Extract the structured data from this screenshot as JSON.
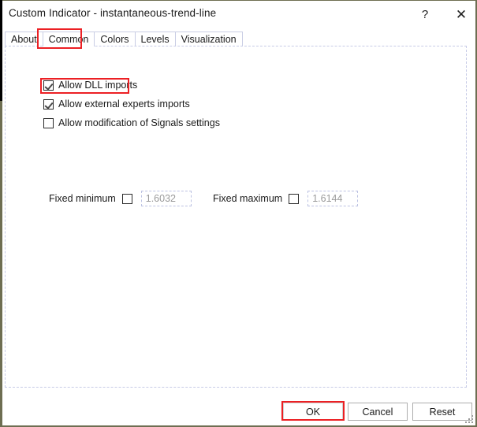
{
  "window": {
    "title": "Custom Indicator - instantaneous-trend-line",
    "help_icon": "question-mark-icon",
    "help_label": "?",
    "close_icon": "close-icon",
    "close_label": "✕"
  },
  "tabs": [
    {
      "label": "About",
      "selected": false
    },
    {
      "label": "Common",
      "selected": true
    },
    {
      "label": "Colors",
      "selected": false
    },
    {
      "label": "Levels",
      "selected": false
    },
    {
      "label": "Visualization",
      "selected": false
    }
  ],
  "common_tab": {
    "checkboxes": [
      {
        "label": "Allow DLL imports",
        "checked": true
      },
      {
        "label": "Allow external experts imports",
        "checked": true
      },
      {
        "label": "Allow modification of Signals settings",
        "checked": false
      }
    ],
    "fixed_minimum": {
      "label": "Fixed minimum",
      "checked": false,
      "value": "1.6032"
    },
    "fixed_maximum": {
      "label": "Fixed maximum",
      "checked": false,
      "value": "1.6144"
    }
  },
  "buttons": {
    "ok": "OK",
    "cancel": "Cancel",
    "reset": "Reset"
  },
  "highlights": {
    "color": "#ec2024",
    "targets": [
      "Common",
      "Allow DLL imports",
      "OK"
    ]
  }
}
